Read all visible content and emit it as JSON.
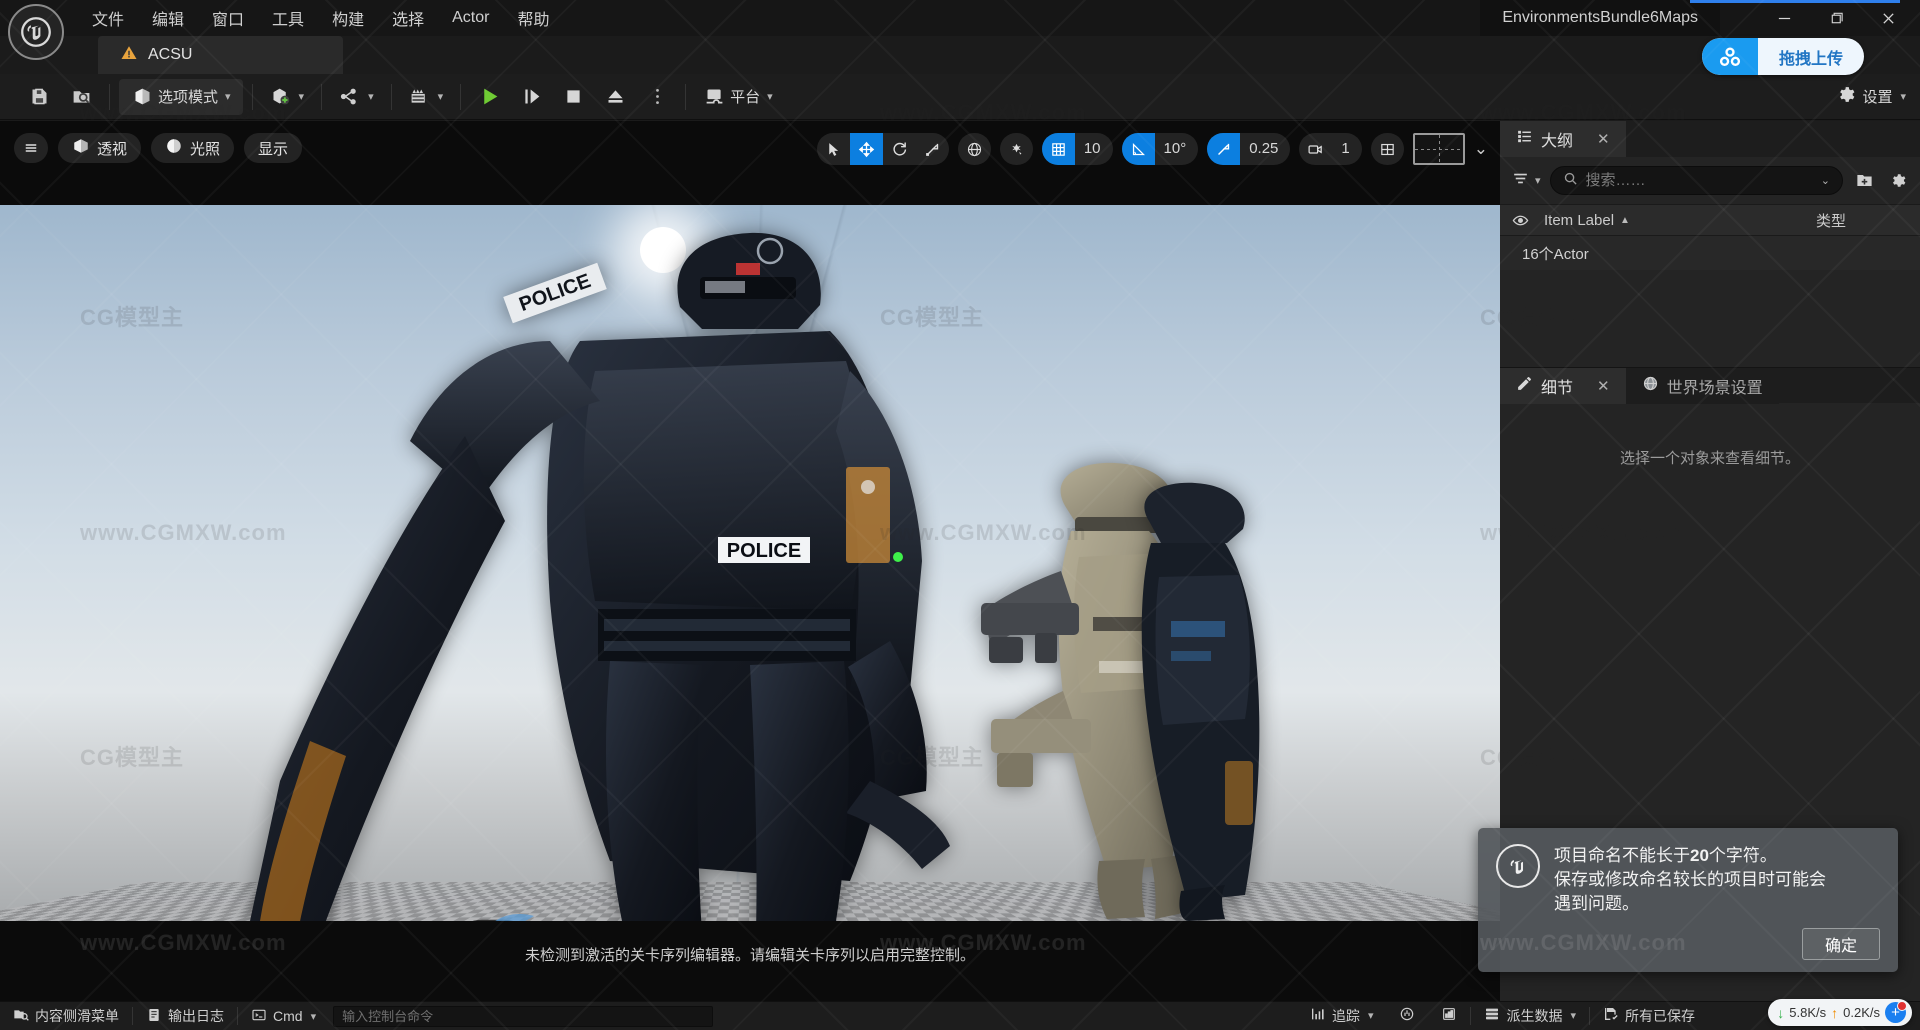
{
  "window": {
    "title": "EnvironmentsBundle6Maps",
    "minimize_label": "最小化",
    "maximize_label": "最大化",
    "close_label": "关闭"
  },
  "menubar": {
    "items": [
      {
        "label": "文件"
      },
      {
        "label": "编辑"
      },
      {
        "label": "窗口"
      },
      {
        "label": "工具"
      },
      {
        "label": "构建"
      },
      {
        "label": "选择"
      },
      {
        "label": "Actor"
      },
      {
        "label": "帮助"
      }
    ]
  },
  "project_tab": {
    "label": "ACSU"
  },
  "toolbar": {
    "save_label": "保存",
    "browse_label": "浏览",
    "mode_label": "选项模式",
    "add_label": "添加",
    "blueprints_label": "蓝图",
    "cinematics_label": "过场动画",
    "play_label": "运行",
    "skip_label": "跳过",
    "stop_label": "停止",
    "eject_label": "弹出",
    "more_label": "更多",
    "platform_label": "平台",
    "upload_label": "拖拽上传",
    "settings_label": "设置"
  },
  "viewport": {
    "menu_label": "菜单",
    "view_mode_label": "透视",
    "lighting_label": "光照",
    "show_label": "显示",
    "select_tool": "选择",
    "move_tool": "移动",
    "rotate_tool": "旋转",
    "scale_tool": "缩放",
    "coord_system": "世界坐标",
    "surface_snap": "表面吸附",
    "grid_snap_value": "10",
    "angle_snap_value": "10°",
    "scale_snap_value": "0.25",
    "camera_speed_value": "1",
    "layout_label": "布局",
    "message": "未检测到激活的关卡序列编辑器。请编辑关卡序列以启用完整控制。",
    "cursor_icon": "gamepad-icon"
  },
  "outliner": {
    "tab_label": "大纲",
    "search_placeholder": "搜索……",
    "search_value": "",
    "filter_label": "筛选",
    "add_label": "添加",
    "settings_label": "设置",
    "columns": {
      "visibility": "可见性",
      "item_label": "Item Label",
      "type": "类型"
    },
    "rows": [
      {
        "label": "16个Actor"
      }
    ]
  },
  "details": {
    "tab_label": "细节",
    "world_settings_label": "世界场景设置",
    "empty_message": "选择一个对象来查看细节。"
  },
  "toast": {
    "line1_prefix": "项目命名不能长于",
    "line1_bold": "20",
    "line1_suffix": "个字符。",
    "line2": "保存或修改命名较长的项目时可能会",
    "line3": "遇到问题。",
    "ok_label": "确定"
  },
  "statusbar": {
    "content_drawer": "内容侧滑菜单",
    "output_log": "输出日志",
    "cmd_label": "Cmd",
    "cmd_placeholder": "输入控制台命令",
    "cmd_value": "",
    "trace_label": "追踪",
    "derived_data_label": "派生数据",
    "saved_label": "所有已保存",
    "network": {
      "down": "5.8K/s",
      "up": "0.2K/s"
    }
  },
  "watermarks": {
    "site": "www.CGMXW.com",
    "brand": "CG模型主"
  },
  "colors": {
    "accent_blue": "#0c7fe0",
    "upload_blue": "#1a9bf0",
    "panel_bg": "#242424",
    "toolbar_bg": "#1d1d1d"
  }
}
